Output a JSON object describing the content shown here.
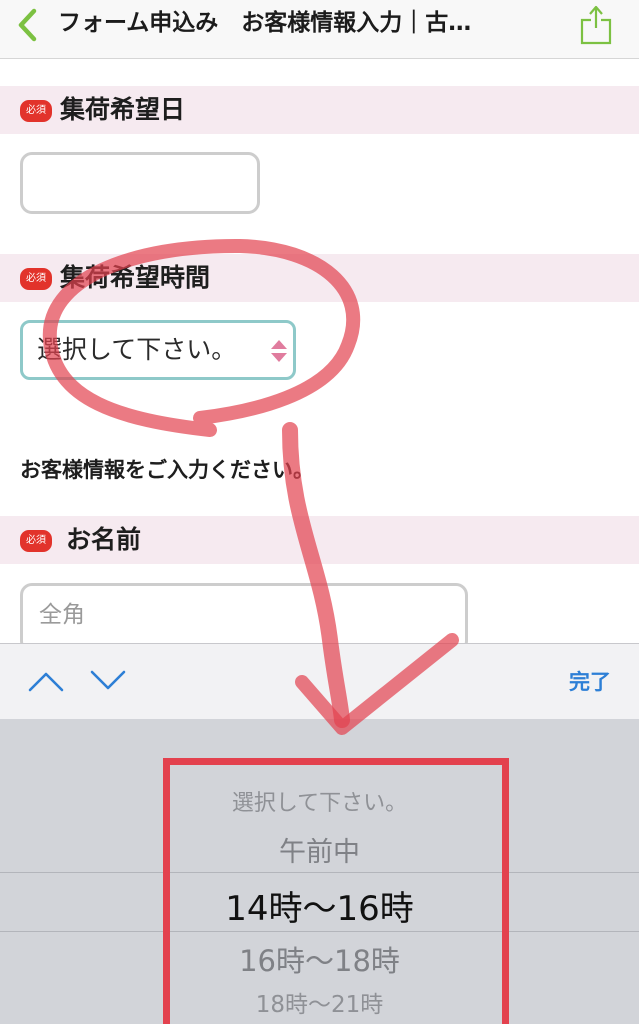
{
  "navbar": {
    "title": "フォーム申込み　お客様情報入力｜古…",
    "back_icon": "chevron-left-icon",
    "share_icon": "share-icon"
  },
  "form": {
    "required_badge": "必須",
    "pickup_date": {
      "label": "集荷希望日",
      "value": ""
    },
    "pickup_time": {
      "label": "集荷希望時間",
      "value": "選択して下さい。"
    },
    "customer_info_heading": "お客様情報をご入力ください。",
    "name": {
      "label": "お名前",
      "placeholder": "全角"
    }
  },
  "accessory_bar": {
    "prev_icon": "chevron-up-icon",
    "next_icon": "chevron-down-icon",
    "done_label": "完了"
  },
  "picker": {
    "options": [
      "選択して下さい。",
      "午前中",
      "14時〜16時",
      "16時〜18時",
      "18時〜21時"
    ],
    "selected_index": 2
  },
  "colors": {
    "section_bg": "#f6eaf0",
    "required_badge": "#e2332b",
    "select_border": "#8ec9c9",
    "done": "#2d7fd6",
    "annotation": "#e3414e",
    "nav_accent": "#7cc142"
  }
}
